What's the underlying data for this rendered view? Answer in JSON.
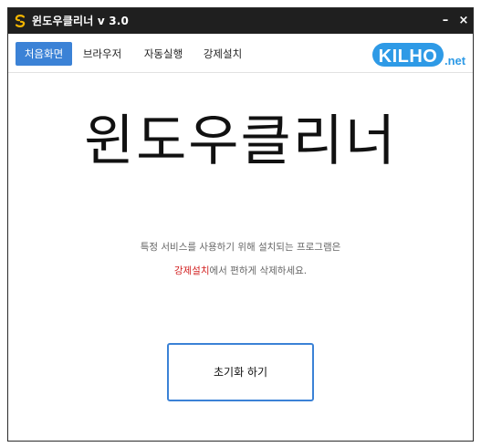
{
  "window": {
    "title": "윈도우클리너 v 3.0",
    "minimize_label": "–",
    "close_label": "×"
  },
  "nav": {
    "items": [
      {
        "label": "처음화면",
        "active": true
      },
      {
        "label": "브라우저",
        "active": false
      },
      {
        "label": "자동실행",
        "active": false
      },
      {
        "label": "강제설치",
        "active": false
      }
    ]
  },
  "logo": {
    "text_main": "KILHO",
    "text_suffix": ".net"
  },
  "main": {
    "hero_title": "윈도우클리너",
    "description_line1": "특정 서비스를 사용하기 위해 설치되는 프로그램은",
    "description_highlight": "강제설치",
    "description_line2_rest": "에서 편하게 삭제하세요.",
    "reset_button_label": "초기화 하기"
  },
  "colors": {
    "titlebar_bg": "#1f1f1f",
    "accent": "#3b82d6",
    "highlight": "#d21f1f",
    "logo_blue": "#2e9ae6"
  },
  "icons": {
    "app": "app-swirl-icon",
    "minimize": "minimize-icon",
    "close": "close-icon"
  }
}
